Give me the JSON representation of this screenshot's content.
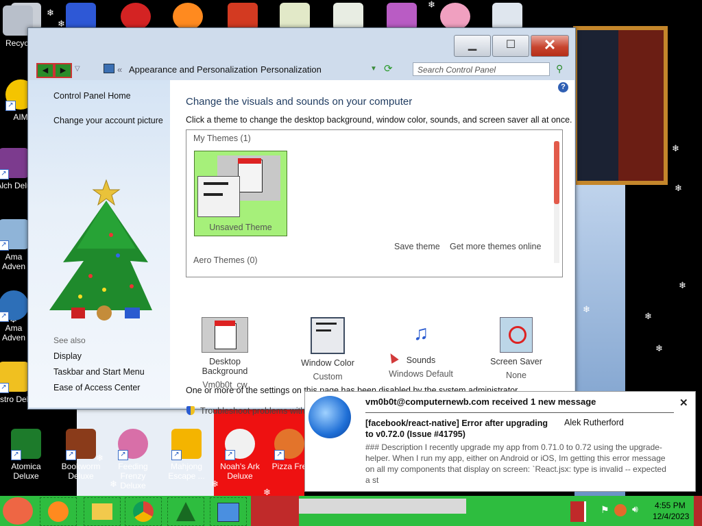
{
  "desktop": {
    "icons_left": [
      {
        "label": "Recycl"
      },
      {
        "label": "AIM"
      },
      {
        "label": "Alch Delu"
      },
      {
        "label": "Ama Adven"
      },
      {
        "label": "Ama Adven"
      },
      {
        "label": "Astro Delu"
      }
    ],
    "icons_bottom": [
      {
        "label": "Atomica Deluxe"
      },
      {
        "label": "Bookworm Deluxe"
      },
      {
        "label": "Feeding Frenzy Deluxe"
      },
      {
        "label": "Mahjong Escape ..."
      },
      {
        "label": "Noah's Ark Deluxe"
      },
      {
        "label": "Pizza Fre"
      }
    ]
  },
  "window": {
    "breadcrumb": [
      "Appearance and Personalization",
      "Personalization"
    ],
    "search_placeholder": "Search Control Panel",
    "left_links": [
      "Control Panel Home",
      "Change your account picture"
    ],
    "see_also_title": "See also",
    "see_also": [
      "Display",
      "Taskbar and Start Menu",
      "Ease of Access Center"
    ],
    "heading": "Change the visuals and sounds on your computer",
    "subheading": "Click a theme to change the desktop background, window color, sounds, and screen saver all at once.",
    "my_themes": "My Themes (1)",
    "unsaved_theme": "Unsaved Theme",
    "save_theme": "Save theme",
    "get_more": "Get more themes online",
    "aero_themes": "Aero Themes (0)",
    "features": [
      {
        "title": "Desktop Background",
        "value": "Vm0b0t_cw"
      },
      {
        "title": "Window Color",
        "value": "Custom"
      },
      {
        "title": "Sounds",
        "value": "Windows Default"
      },
      {
        "title": "Screen Saver",
        "value": "None"
      }
    ],
    "disabled_note": "One or more of the settings on this page has been disabled by the system administrator.",
    "troubleshoot": "Troubleshoot problems with transparency and other Aero effects"
  },
  "toast": {
    "title": "vm0b0t@computernewb.com received 1 new message",
    "subject": "[facebook/react-native] Error after upgrading to v0.72.0 (Issue #41795)",
    "sender": "Alek Rutherford",
    "body": "### Description I recently upgrade my app from 0.71.0 to 0.72 using the upgrade-helper. When I run my app, either on Android or iOS, Im getting this error message on all my components that display on screen: `React.jsx: type is invalid -- expected a st"
  },
  "clock": {
    "time": "4:55 PM",
    "date": "12/4/2023"
  },
  "colors": {
    "taskbar": "#2ebd3f",
    "accent_green": "#a6f07a",
    "link": "#1a1a1a"
  }
}
